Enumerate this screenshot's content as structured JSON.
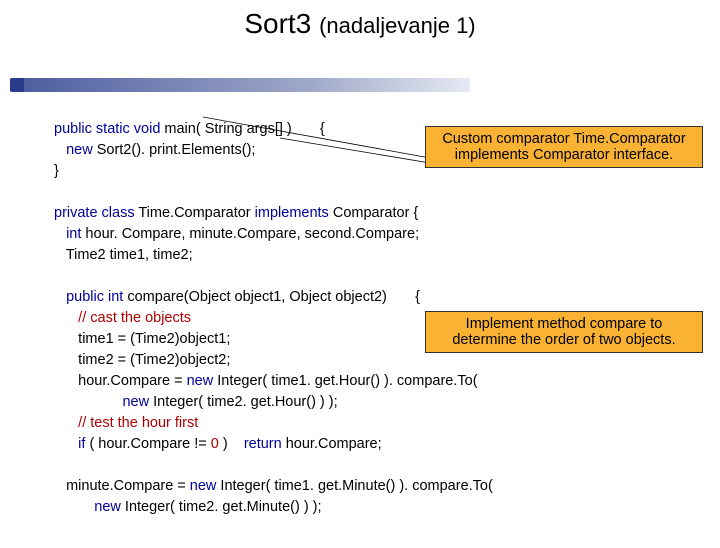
{
  "title": {
    "main": "Sort3",
    "sub": "(nadaljevanje 1)"
  },
  "callouts": {
    "c1": "Custom comparator Time.Comparator implements Comparator interface.",
    "c2": "Implement method compare to determine the order of two objects."
  },
  "code": {
    "l1a": "public static void",
    "l1b": " main( String args[] )       {",
    "l2a": "   new",
    "l2b": " Sort2(). print.Elements();",
    "l3": "}",
    "blank1": " ",
    "l4a": "private class",
    "l4b": " Time.Comparator ",
    "l4c": "implements",
    "l4d": " Comparator {",
    "l5a": "   int",
    "l5b": " hour. Compare, minute.Compare, second.Compare;",
    "l6": "   Time2 time1, time2;",
    "blank2": " ",
    "l7a": "   public int",
    "l7b": " compare(Object object1, Object object2)       {",
    "l8a": "      // cast the objects",
    "l9": "      time1 = (Time2)object1;",
    "l10": "      time2 = (Time2)object2;",
    "l11a": "      hour.Compare = ",
    "l11b": "new",
    "l11c": " Integer( time1. get.Hour() ). compare.To(",
    "l12a": "                 new",
    "l12b": " Integer( time2. get.Hour() ) );",
    "l13a": "      // test the hour first",
    "l14a": "      if",
    "l14b": " ( hour.Compare != ",
    "l14c": "0",
    "l14d": " )    ",
    "l14e": "return",
    "l14f": " hour.Compare;",
    "blank3": " ",
    "l15a": "   minute.Compare = ",
    "l15b": "new",
    "l15c": " Integer( time1. get.Minute() ). compare.To(",
    "l16a": "          new",
    "l16b": " Integer( time2. get.Minute() ) );"
  }
}
